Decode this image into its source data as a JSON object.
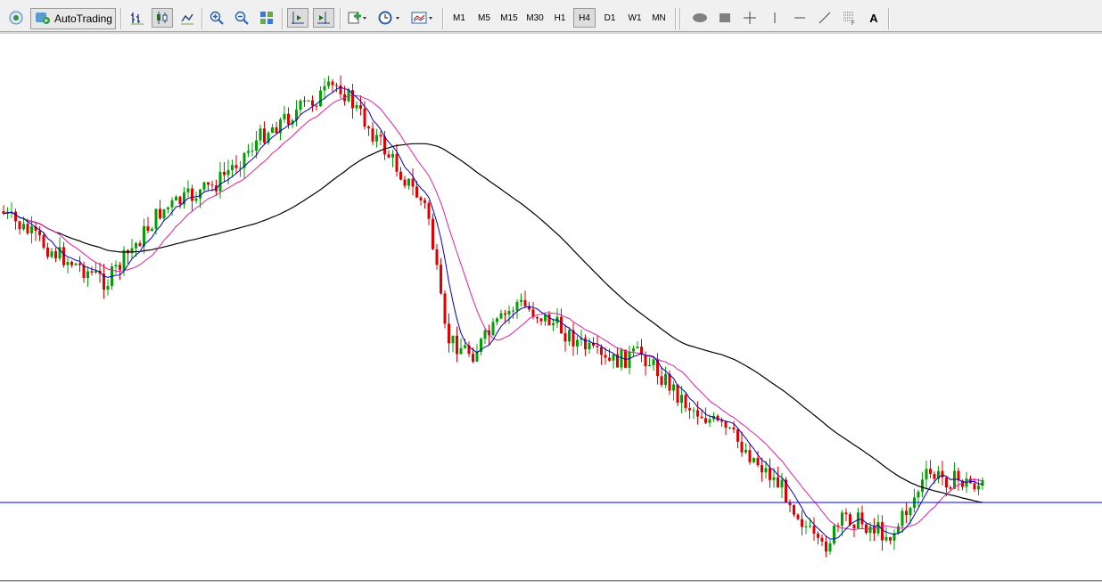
{
  "toolbar": {
    "autotrading_label": "AutoTrading",
    "timeframes": [
      "M1",
      "M5",
      "M15",
      "M30",
      "H1",
      "H4",
      "D1",
      "W1",
      "MN"
    ],
    "active_timeframe": "H4",
    "text_tool_label": "A",
    "icons": [
      "network-icon",
      "autotrading-icon",
      "bar-chart-icon",
      "candlestick-icon",
      "line-chart-icon",
      "zoom-in-icon",
      "zoom-out-icon",
      "tile-windows-icon",
      "chart-shift-icon",
      "auto-scroll-icon",
      "indicators-icon",
      "periodicity-icon",
      "templates-icon",
      "ellipse-tool-icon",
      "rectangle-tool-icon",
      "crosshair-icon",
      "vertical-line-icon",
      "horizontal-line-icon",
      "trendline-icon",
      "fibonacci-icon",
      "text-tool-icon"
    ]
  },
  "colors": {
    "bull_candle": "#00a000",
    "bear_candle": "#e00000",
    "ma_fast": "#0000c0",
    "ma_slow": "#e0209f",
    "ma_long": "#000000",
    "horizontal_level": "#0000ff"
  },
  "chart_data": {
    "type": "candlestick",
    "title": "",
    "price_axis_visible": false,
    "grid": false,
    "description_of_series": [
      "price candles",
      "fast moving average",
      "medium moving average",
      "long moving average",
      "horizontal price level"
    ],
    "price_trend_points_relative": [
      [
        0,
        0.3
      ],
      [
        60,
        0.38
      ],
      [
        120,
        0.44
      ],
      [
        180,
        0.3
      ],
      [
        240,
        0.25
      ],
      [
        300,
        0.14
      ],
      [
        380,
        0.05
      ],
      [
        440,
        0.2
      ],
      [
        480,
        0.3
      ],
      [
        500,
        0.55
      ],
      [
        530,
        0.58
      ],
      [
        580,
        0.48
      ],
      [
        620,
        0.52
      ],
      [
        680,
        0.6
      ],
      [
        720,
        0.58
      ],
      [
        770,
        0.68
      ],
      [
        820,
        0.74
      ],
      [
        880,
        0.85
      ],
      [
        920,
        0.97
      ],
      [
        950,
        0.9
      ],
      [
        1000,
        0.94
      ],
      [
        1040,
        0.82
      ],
      [
        1100,
        0.84
      ]
    ]
  }
}
